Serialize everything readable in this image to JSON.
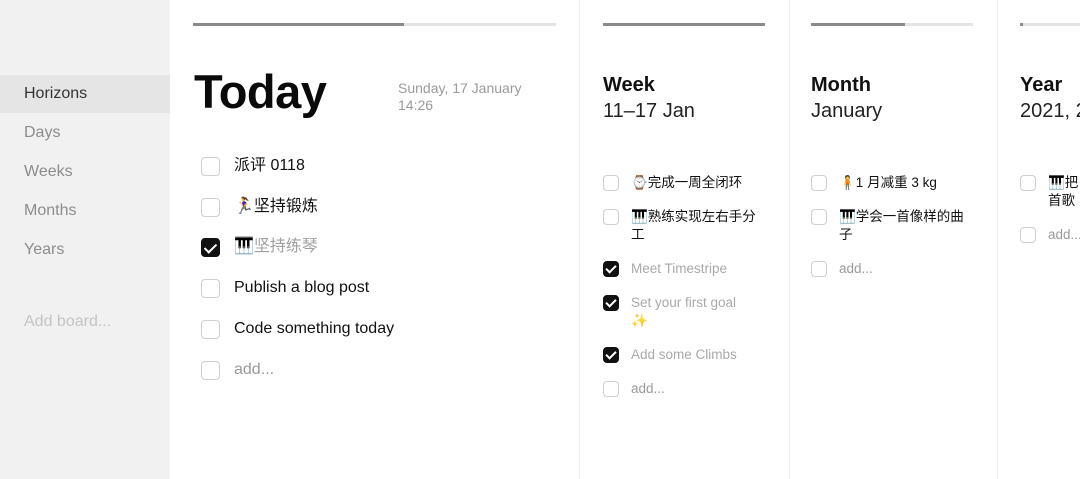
{
  "sidebar": {
    "items": [
      {
        "label": "Horizons",
        "active": true
      },
      {
        "label": "Days",
        "active": false
      },
      {
        "label": "Weeks",
        "active": false
      },
      {
        "label": "Months",
        "active": false
      },
      {
        "label": "Years",
        "active": false
      }
    ],
    "add_board": "Add board..."
  },
  "today": {
    "title": "Today",
    "date_line1": "Sunday, 17 January",
    "date_line2": "14:26",
    "progress": 0.58,
    "tasks": [
      {
        "text": "派评 0118",
        "done": false
      },
      {
        "text": "🏃‍♀️坚持锻炼",
        "done": false
      },
      {
        "text": "🎹坚持练琴",
        "done": true
      },
      {
        "text": "Publish a blog post",
        "done": false
      },
      {
        "text": "Code something today",
        "done": false
      }
    ],
    "add_label": "add..."
  },
  "week": {
    "title": "Week",
    "subtitle": "11–17 Jan",
    "progress": 1.0,
    "tasks": [
      {
        "text": "⌚完成一周全闭环",
        "done": false
      },
      {
        "text": "🎹熟练实现左右手分",
        "text2": "工",
        "done": false
      },
      {
        "text": "Meet Timestripe",
        "done": true
      },
      {
        "text": "Set your first goal",
        "text2": "✨",
        "done": true
      },
      {
        "text": "Add some Climbs",
        "done": true
      }
    ],
    "add_label": "add..."
  },
  "month": {
    "title": "Month",
    "subtitle": "January",
    "progress": 0.58,
    "tasks": [
      {
        "text": "🧍1 月减重 3 kg",
        "done": false
      },
      {
        "text": "🎹学会一首像样的曲",
        "text2": "子",
        "done": false
      }
    ],
    "add_label": "add..."
  },
  "year": {
    "title": "Year",
    "subtitle": "2021, 2",
    "progress": 0.05,
    "tasks": [
      {
        "text": "🎹把",
        "text2": "首歌",
        "done": false
      }
    ],
    "add_label": "add..."
  }
}
